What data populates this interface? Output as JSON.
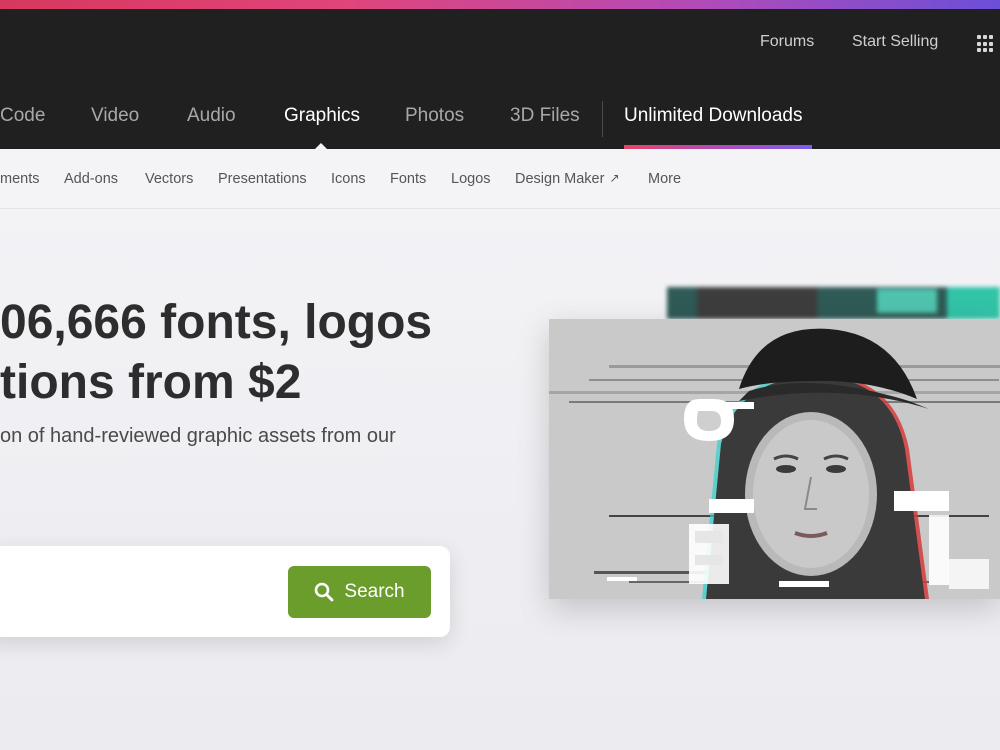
{
  "utility_nav": {
    "forums": "Forums",
    "start_selling": "Start Selling",
    "apps_icon": "apps-grid-icon"
  },
  "main_nav": {
    "items": [
      {
        "label": "Code",
        "active": false
      },
      {
        "label": "Video",
        "active": false
      },
      {
        "label": "Audio",
        "active": false
      },
      {
        "label": "Graphics",
        "active": true
      },
      {
        "label": "Photos",
        "active": false
      },
      {
        "label": "3D Files",
        "active": false
      }
    ],
    "unlimited": "Unlimited Downloads"
  },
  "sub_nav": {
    "items": [
      "ments",
      "Add-ons",
      "Vectors",
      "Presentations",
      "Icons",
      "Fonts",
      "Logos",
      "Design Maker",
      "More"
    ],
    "external_icon": "external-link-icon"
  },
  "hero": {
    "headline_1": "06,666 fonts, logos",
    "headline_2": "tions from $2",
    "subheading": "on of hand-reviewed graphic assets from our",
    "search": {
      "placeholder": "",
      "value": "",
      "button_label": "Search",
      "icon": "search-icon"
    }
  },
  "colors": {
    "top_bar": "#202020",
    "brand_gradient": [
      "#d7385e",
      "#b24bb8",
      "#6b4fd8"
    ],
    "search_button": "#6a9d2b",
    "hero_background": "#f3f3f6"
  }
}
